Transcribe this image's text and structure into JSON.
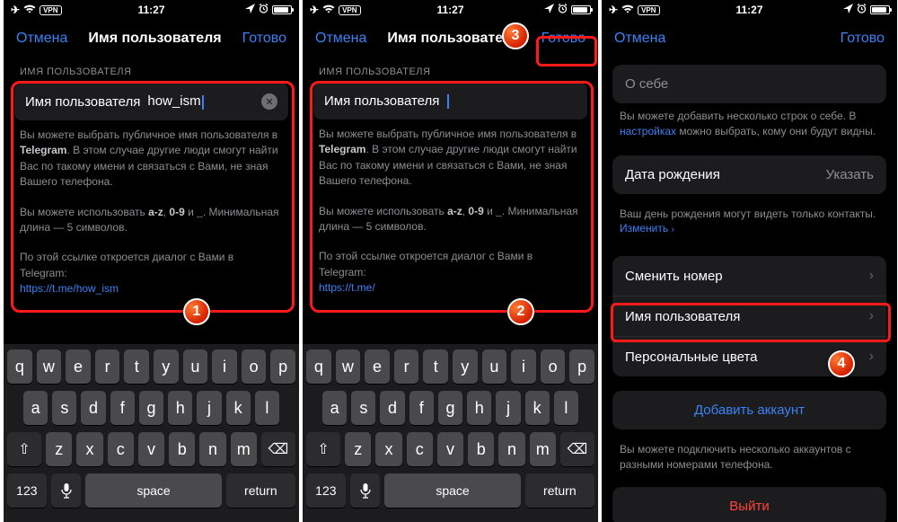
{
  "status": {
    "time": "11:27",
    "vpn": "VPN"
  },
  "s1": {
    "cancel": "Отмена",
    "title": "Имя пользователя",
    "done": "Готово",
    "section_label": "ИМЯ ПОЛЬЗОВАТЕЛЯ",
    "field_label": "Имя пользователя",
    "field_value": "how_ism",
    "help_p1a": "Вы можете выбрать публичное имя пользователя в ",
    "help_p1_app": "Telegram",
    "help_p1b": ". В этом случае другие люди смогут найти Вас по такому имени и связаться с Вами, не зная Вашего телефона.",
    "help_p2a": "Вы можете использовать ",
    "help_p2_chars": "a-z",
    "help_p2_sep1": ", ",
    "help_p2_digits": "0-9",
    "help_p2_sep2": " и ",
    "help_p2_under": "_",
    "help_p2b": ". Минимальная длина — 5 символов.",
    "help_p3": "По этой ссылке откроется диалог с Вами в Telegram:",
    "link": "https://t.me/how_ism",
    "badge": "1"
  },
  "s2": {
    "cancel": "Отмена",
    "title": "Имя пользователя",
    "done": "Готово",
    "section_label": "ИМЯ ПОЛЬЗОВАТЕЛЯ",
    "field_label": "Имя пользователя",
    "field_value": "",
    "link": "https://t.me/",
    "badge_content": "2",
    "badge_done": "3"
  },
  "s3": {
    "cancel": "Отмена",
    "done": "Готово",
    "about_placeholder": "О себе",
    "about_note_a": "Вы можете добавить несколько строк о себе. В ",
    "about_note_link": "настройках",
    "about_note_b": " можно выбрать, кому они будут видны.",
    "dob_label": "Дата рождения",
    "dob_value": "Указать",
    "dob_note_a": "Ваш день рождения могут видеть только контакты. ",
    "dob_note_link": "Изменить",
    "change_number": "Сменить номер",
    "username": "Имя пользователя",
    "colors": "Персональные цвета",
    "add_account": "Добавить аккаунт",
    "add_note": "Вы можете подключить несколько аккаунтов с разными номерами телефона.",
    "logout": "Выйти",
    "badge": "4"
  },
  "kb": {
    "row1": [
      "q",
      "w",
      "e",
      "r",
      "t",
      "y",
      "u",
      "i",
      "o",
      "p"
    ],
    "row2": [
      "a",
      "s",
      "d",
      "f",
      "g",
      "h",
      "j",
      "k",
      "l"
    ],
    "row3": [
      "z",
      "x",
      "c",
      "v",
      "b",
      "n",
      "m"
    ],
    "k123": "123",
    "space": "space",
    "return": "return"
  }
}
